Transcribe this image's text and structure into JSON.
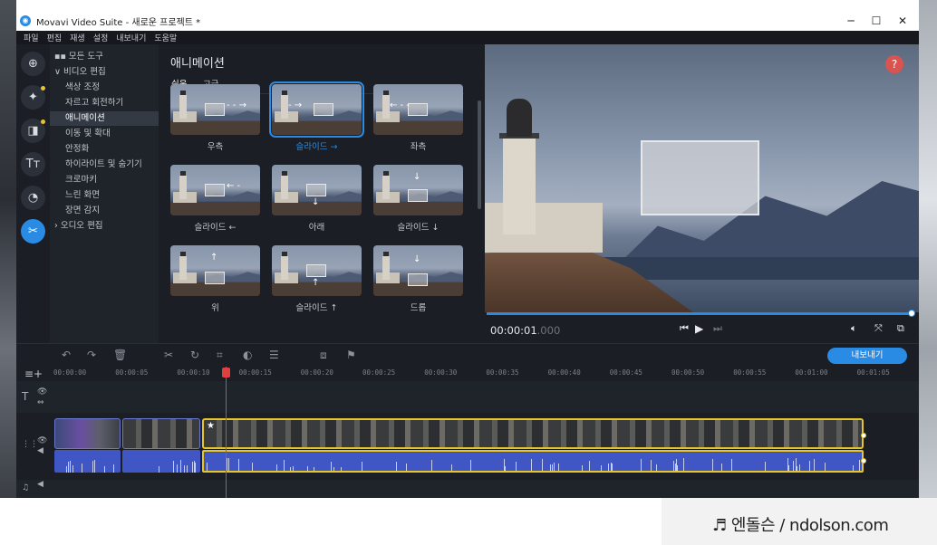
{
  "window": {
    "title": "Movavi Video Suite - 새로운 프로젝트 *",
    "minimize": "─",
    "maximize": "☐",
    "close": "✕"
  },
  "menu": [
    "파일",
    "편집",
    "재생",
    "설정",
    "내보내기",
    "도움말"
  ],
  "rail": [
    {
      "icon": "import-icon",
      "glyph": "⊕",
      "active": false,
      "dot": false
    },
    {
      "icon": "magic-wand-icon",
      "glyph": "✦",
      "active": false,
      "dot": true
    },
    {
      "icon": "transition-icon",
      "glyph": "◨",
      "active": false,
      "dot": true
    },
    {
      "icon": "titles-icon",
      "glyph": "Tт",
      "active": false,
      "dot": false
    },
    {
      "icon": "stickers-icon",
      "glyph": "◔",
      "active": false,
      "dot": false
    },
    {
      "icon": "tools-icon",
      "glyph": "✂",
      "active": true,
      "dot": false
    }
  ],
  "tree": [
    {
      "label": "모든 도구",
      "prefix": "▪▪ ",
      "indent": 0,
      "selected": false
    },
    {
      "label": "비디오 편집",
      "prefix": "∨ ",
      "indent": 0,
      "selected": false
    },
    {
      "label": "색상 조정",
      "prefix": "",
      "indent": 1,
      "selected": false
    },
    {
      "label": "자르고 회전하기",
      "prefix": "",
      "indent": 1,
      "selected": false
    },
    {
      "label": "애니메이션",
      "prefix": "",
      "indent": 1,
      "selected": true
    },
    {
      "label": "이동 및 확대",
      "prefix": "",
      "indent": 1,
      "selected": false
    },
    {
      "label": "안정화",
      "prefix": "",
      "indent": 1,
      "selected": false
    },
    {
      "label": "하이라이트 및 숨기기",
      "prefix": "",
      "indent": 1,
      "selected": false
    },
    {
      "label": "크로마키",
      "prefix": "",
      "indent": 1,
      "selected": false
    },
    {
      "label": "느린 화면",
      "prefix": "",
      "indent": 1,
      "selected": false
    },
    {
      "label": "장면 감지",
      "prefix": "",
      "indent": 1,
      "selected": false
    },
    {
      "label": "오디오 편집",
      "prefix": "› ",
      "indent": 0,
      "selected": false
    }
  ],
  "animation": {
    "title": "애니메이션",
    "tabs": [
      {
        "label": "쉬움",
        "active": true
      },
      {
        "label": "고급",
        "active": false
      }
    ],
    "presets": [
      {
        "label": "우측",
        "selected": false,
        "arrow": "- - →",
        "motion": "right"
      },
      {
        "label": "슬라이드 →",
        "selected": true,
        "arrow": "- →",
        "motion": "slide-right"
      },
      {
        "label": "좌측",
        "selected": false,
        "arrow": "← - -",
        "motion": "left"
      },
      {
        "label": "슬라이드 ←",
        "selected": false,
        "arrow": "← -",
        "motion": "slide-left"
      },
      {
        "label": "아래",
        "selected": false,
        "arrow": "↓",
        "motion": "down"
      },
      {
        "label": "슬라이드 ↓",
        "selected": false,
        "arrow": "↓",
        "motion": "slide-down"
      },
      {
        "label": "위",
        "selected": false,
        "arrow": "↑",
        "motion": "up"
      },
      {
        "label": "슬라이드 ↑",
        "selected": false,
        "arrow": "↑",
        "motion": "slide-up"
      },
      {
        "label": "드롭",
        "selected": false,
        "arrow": "↓",
        "motion": "drop"
      }
    ]
  },
  "preview": {
    "help": "?",
    "time_main": "00:00:01",
    "time_ms": ".000",
    "progress": 1.0
  },
  "toolbar": {
    "export_label": "내보내기"
  },
  "ruler": [
    "00:00:00",
    "00:00:05",
    "00:00:10",
    "00:00:15",
    "00:00:20",
    "00:00:25",
    "00:00:30",
    "00:00:35",
    "00:00:40",
    "00:00:45",
    "00:00:50",
    "00:00:55",
    "00:01:00",
    "00:01:05"
  ],
  "watermark": "♬ 엔돌슨 / ndolson.com",
  "colors": {
    "accent": "#2a8be5",
    "selection_clip": "#e6c52a",
    "playhead": "#e04040",
    "audio": "#3f56c4",
    "help": "#d9534f"
  }
}
